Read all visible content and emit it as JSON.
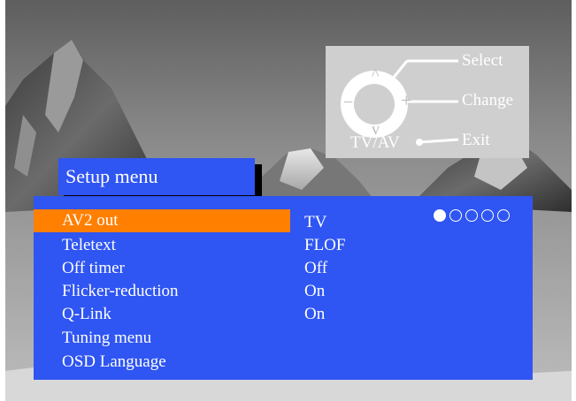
{
  "remote": {
    "select_label": "Select",
    "change_label": "Change",
    "exit_label": "Exit",
    "tvav_label": "TV/AV",
    "up_symbol": "^",
    "down_symbol": "v",
    "minus_symbol": "−",
    "plus_symbol": "+"
  },
  "menu": {
    "title": "Setup menu",
    "items": [
      {
        "label": "AV2 out",
        "value": "TV",
        "selected": true
      },
      {
        "label": "Teletext",
        "value": "FLOF"
      },
      {
        "label": "Off timer",
        "value": "Off"
      },
      {
        "label": "Flicker-reduction",
        "value": "On"
      },
      {
        "label": "Q-Link",
        "value": "On"
      },
      {
        "label": "Tuning menu",
        "value": ""
      },
      {
        "label": "OSD Language",
        "value": ""
      }
    ],
    "option_count": 5,
    "option_selected_index": 0
  },
  "colors": {
    "menu_blue": "#2f55f2",
    "highlight_orange": "#ff7f00",
    "remote_panel": "#cfcfcf",
    "text": "#ffffff"
  }
}
